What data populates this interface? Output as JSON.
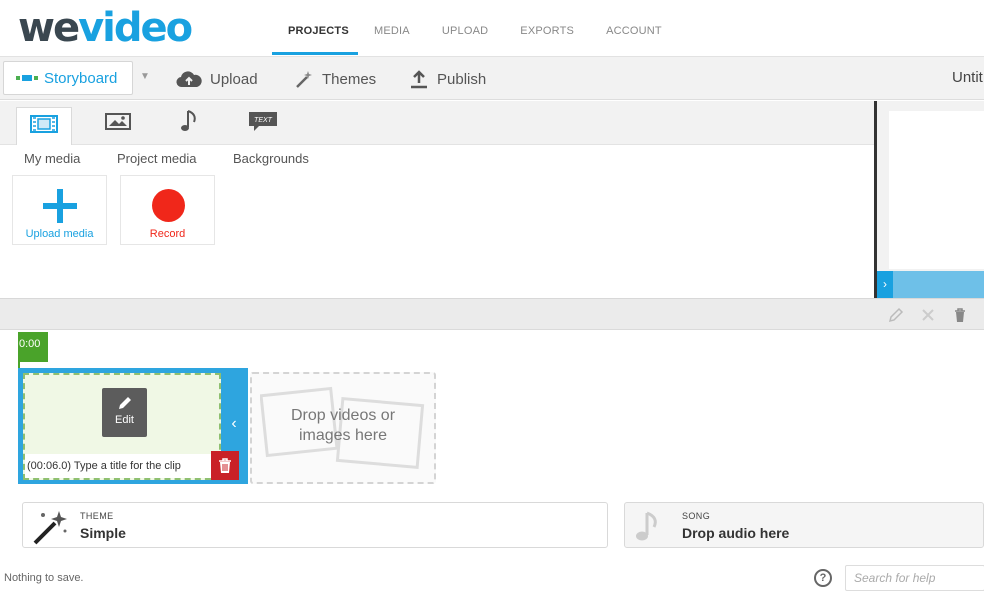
{
  "logo": {
    "part1": "we",
    "part2": "video"
  },
  "nav": {
    "tabs": [
      "PROJECTS",
      "MEDIA",
      "UPLOAD",
      "EXPORTS",
      "ACCOUNT"
    ],
    "active": "PROJECTS"
  },
  "toolbar": {
    "storyboard_label": "Storyboard",
    "upload_label": "Upload",
    "themes_label": "Themes",
    "publish_label": "Publish",
    "project_title": "Untit"
  },
  "media": {
    "subtabs": [
      "My media",
      "Project media",
      "Backgrounds"
    ],
    "text_tab_label": "TEXT",
    "upload_tile_label": "Upload media",
    "record_tile_label": "Record"
  },
  "timeline": {
    "time_marker": "0:00",
    "clip_edit_label": "Edit",
    "clip_title": "(00:06.0) Type a title for the clip",
    "drop_text_line1": "Drop videos or",
    "drop_text_line2": "images here",
    "theme_caption": "THEME",
    "theme_value": "Simple",
    "song_caption": "SONG",
    "song_value": "Drop audio here"
  },
  "status": {
    "save_text": "Nothing to save.",
    "help_placeholder": "Search for help",
    "help_icon": "?"
  },
  "colors": {
    "brand_blue": "#19a1e0",
    "dark": "#3a4750",
    "green": "#4aa32a",
    "record_red": "#f0271a",
    "delete_red": "#c92127"
  }
}
